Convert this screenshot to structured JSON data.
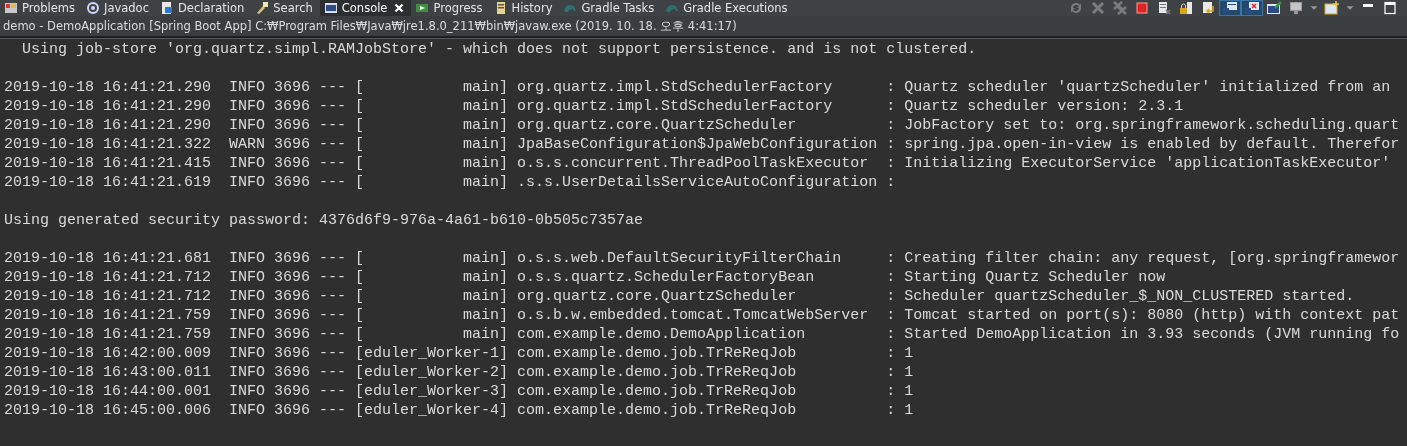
{
  "tabs": [
    {
      "label": "Problems",
      "kind": "problems",
      "selected": false,
      "closable": false
    },
    {
      "label": "Javadoc",
      "kind": "javadoc",
      "selected": false,
      "closable": false
    },
    {
      "label": "Declaration",
      "kind": "declaration",
      "selected": false,
      "closable": false
    },
    {
      "label": "Search",
      "kind": "search",
      "selected": false,
      "closable": false
    },
    {
      "label": "Console",
      "kind": "console",
      "selected": true,
      "closable": true
    },
    {
      "label": "Progress",
      "kind": "progress",
      "selected": false,
      "closable": false
    },
    {
      "label": "History",
      "kind": "history",
      "selected": false,
      "closable": false
    },
    {
      "label": "Gradle Tasks",
      "kind": "gradle",
      "selected": false,
      "closable": false
    },
    {
      "label": "Gradle Executions",
      "kind": "gradle",
      "selected": false,
      "closable": false
    }
  ],
  "toolbar": [
    {
      "kind": "sync",
      "disabled": true,
      "selected": false
    },
    {
      "kind": "remove",
      "disabled": true,
      "selected": false
    },
    {
      "kind": "remove-all",
      "disabled": true,
      "selected": false
    },
    {
      "kind": "terminate",
      "disabled": false,
      "selected": false
    },
    {
      "kind": "clear",
      "disabled": false,
      "selected": false
    },
    {
      "kind": "scroll-lock",
      "disabled": false,
      "selected": false
    },
    {
      "kind": "word-wrap",
      "disabled": false,
      "selected": false
    },
    {
      "kind": "show-out",
      "disabled": false,
      "selected": true
    },
    {
      "kind": "show-err",
      "disabled": false,
      "selected": true
    },
    {
      "kind": "pin",
      "disabled": false,
      "selected": false
    },
    {
      "kind": "display",
      "disabled": false,
      "selected": false
    },
    {
      "kind": "caret",
      "disabled": false,
      "selected": false
    },
    {
      "kind": "new-console",
      "disabled": false,
      "selected": false
    },
    {
      "kind": "caret",
      "disabled": false,
      "selected": false
    },
    {
      "kind": "minimize",
      "disabled": false,
      "selected": false
    },
    {
      "kind": "maximize",
      "disabled": false,
      "selected": false
    }
  ],
  "console": {
    "title": "demo - DemoApplication [Spring Boot App] C:₩Program Files₩Java₩jre1.8.0_211₩bin₩javaw.exe (2019. 10. 18. 오후 4:41:17)",
    "blocks": [
      [
        "  Using job-store 'org.quartz.simpl.RAMJobStore' - which does not support persistence. and is not clustered."
      ],
      [
        "2019-10-18 16:41:21.290  INFO 3696 --- [           main] org.quartz.impl.StdSchedulerFactory      : Quartz scheduler 'quartzScheduler' initialized from an",
        "2019-10-18 16:41:21.290  INFO 3696 --- [           main] org.quartz.impl.StdSchedulerFactory      : Quartz scheduler version: 2.3.1",
        "2019-10-18 16:41:21.290  INFO 3696 --- [           main] org.quartz.core.QuartzScheduler          : JobFactory set to: org.springframework.scheduling.quart",
        "2019-10-18 16:41:21.322  WARN 3696 --- [           main] JpaBaseConfiguration$JpaWebConfiguration : spring.jpa.open-in-view is enabled by default. Therefor",
        "2019-10-18 16:41:21.415  INFO 3696 --- [           main] o.s.s.concurrent.ThreadPoolTaskExecutor  : Initializing ExecutorService 'applicationTaskExecutor'",
        "2019-10-18 16:41:21.619  INFO 3696 --- [           main] .s.s.UserDetailsServiceAutoConfiguration :"
      ],
      [
        "Using generated security password: 4376d6f9-976a-4a61-b610-0b505c7357ae"
      ],
      [
        "2019-10-18 16:41:21.681  INFO 3696 --- [           main] o.s.s.web.DefaultSecurityFilterChain     : Creating filter chain: any request, [org.springframewor",
        "2019-10-18 16:41:21.712  INFO 3696 --- [           main] o.s.s.quartz.SchedulerFactoryBean        : Starting Quartz Scheduler now",
        "2019-10-18 16:41:21.712  INFO 3696 --- [           main] org.quartz.core.QuartzScheduler          : Scheduler quartzScheduler_$_NON_CLUSTERED started.",
        "2019-10-18 16:41:21.759  INFO 3696 --- [           main] o.s.b.w.embedded.tomcat.TomcatWebServer  : Tomcat started on port(s): 8080 (http) with context pat",
        "2019-10-18 16:41:21.759  INFO 3696 --- [           main] com.example.demo.DemoApplication         : Started DemoApplication in 3.93 seconds (JVM running fo",
        "2019-10-18 16:42:00.009  INFO 3696 --- [eduler_Worker-1] com.example.demo.job.TrReReqJob          : 1",
        "2019-10-18 16:43:00.011  INFO 3696 --- [eduler_Worker-2] com.example.demo.job.TrReReqJob          : 1",
        "2019-10-18 16:44:00.001  INFO 3696 --- [eduler_Worker-3] com.example.demo.job.TrReReqJob          : 1",
        "2019-10-18 16:45:00.006  INFO 3696 --- [eduler_Worker-4] com.example.demo.job.TrReReqJob          : 1"
      ]
    ]
  }
}
